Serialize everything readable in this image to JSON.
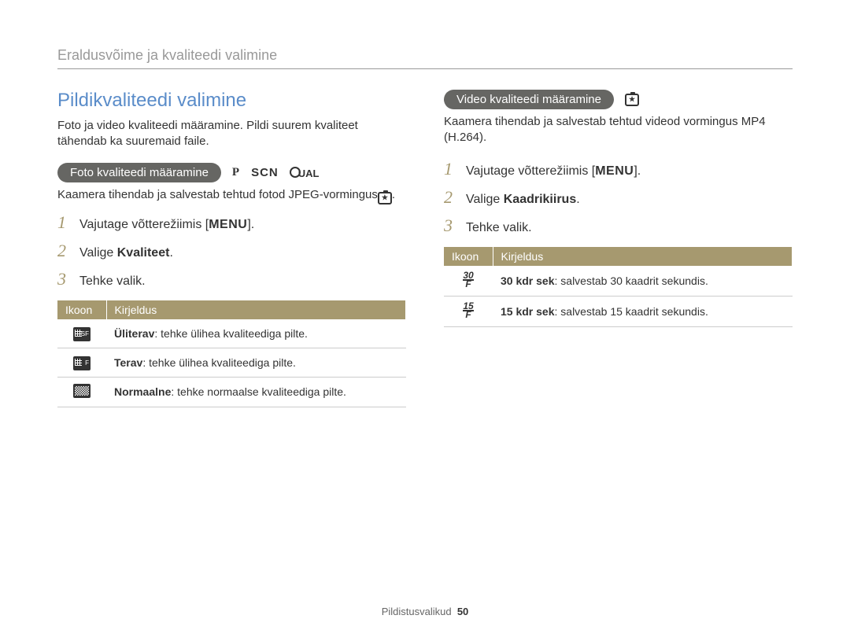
{
  "header": {
    "title": "Eraldusvõime ja kvaliteedi valimine"
  },
  "left": {
    "section_title": "Pildikvaliteedi valimine",
    "intro": "Foto ja video kvaliteedi määramine. Pildi suurem kvaliteet tähendab ka suuremaid faile.",
    "foto_pill": "Foto kvaliteedi määramine",
    "mode_p": "P",
    "mode_scn": "SCN",
    "mode_dual": "UAL",
    "foto_desc_pre": "Kaamera tihendab ja salvestab tehtud fotod JPEG-vormingus",
    "steps": [
      {
        "num": "1",
        "pre": "Vajutage võtterežiimis [",
        "menu": "MENU",
        "post": "]."
      },
      {
        "num": "2",
        "pre": "Valige ",
        "bold": "Kvaliteet",
        "post": "."
      },
      {
        "num": "3",
        "pre": "Tehke valik.",
        "bold": "",
        "post": ""
      }
    ],
    "table": {
      "headers": [
        "Ikoon",
        "Kirjeldus"
      ],
      "rows": [
        {
          "icon": "SF",
          "term": "Üliterav",
          "desc": ": tehke ülihea kvaliteediga pilte."
        },
        {
          "icon": "F",
          "term": "Terav",
          "desc": ": tehke ülihea kvaliteediga pilte."
        },
        {
          "icon": "N",
          "term": "Normaalne",
          "desc": ": tehke normaalse kvaliteediga pilte."
        }
      ]
    }
  },
  "right": {
    "video_pill": "Video kvaliteedi määramine",
    "video_desc": "Kaamera tihendab ja salvestab tehtud videod vormingus MP4 (H.264).",
    "steps": [
      {
        "num": "1",
        "pre": "Vajutage võtterežiimis [",
        "menu": "MENU",
        "post": "]."
      },
      {
        "num": "2",
        "pre": "Valige ",
        "bold": "Kaadrikiirus",
        "post": "."
      },
      {
        "num": "3",
        "pre": "Tehke valik.",
        "bold": "",
        "post": ""
      }
    ],
    "table": {
      "headers": [
        "Ikoon",
        "Kirjeldus"
      ],
      "rows": [
        {
          "icon_top": "30",
          "icon_bot": "F",
          "term": "30 kdr sek",
          "desc": ": salvestab 30 kaadrit sekundis."
        },
        {
          "icon_top": "15",
          "icon_bot": "F",
          "term": "15 kdr sek",
          "desc": ": salvestab 15 kaadrit sekundis."
        }
      ]
    }
  },
  "footer": {
    "section": "Pildistusvalikud",
    "page": "50"
  }
}
